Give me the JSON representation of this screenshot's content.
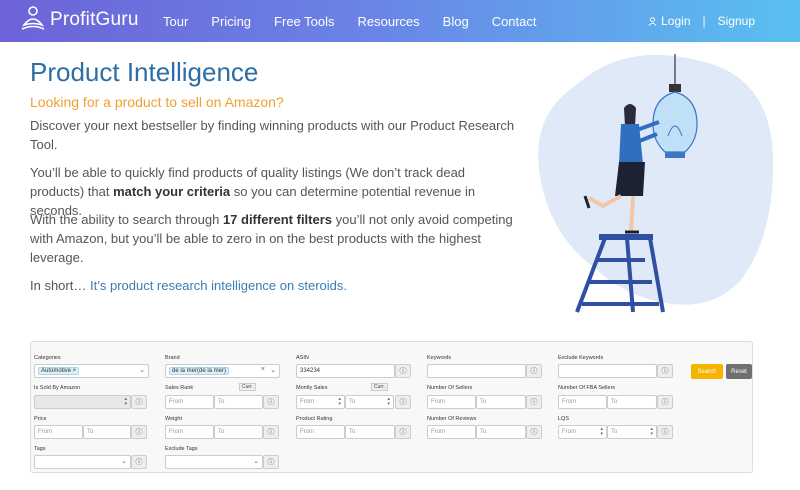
{
  "nav": {
    "logo_text": "ProfitGuru",
    "items": [
      "Tour",
      "Pricing",
      "Free Tools",
      "Resources",
      "Blog",
      "Contact"
    ],
    "login": "Login",
    "separator": "|",
    "signup": "Signup"
  },
  "hero": {
    "title": "Product Intelligence",
    "subtitle": "Looking for a product to sell on Amazon?",
    "p1": "Discover your next bestseller by finding winning products with our Product Research Tool.",
    "p2_a": "You’ll be able to quickly find products of quality listings (We don’t track dead products) that ",
    "p2_b": "match your criteria",
    "p2_c": " so you can determine potential revenue in seconds.",
    "p3_a": "With the ability to search through ",
    "p3_b": "17 different filters",
    "p3_c": " you’ll not only avoid competing with Amazon, but you’ll be able to zero in on the best products with the highest leverage.",
    "p4_a": "In short… ",
    "p4_b": "It’s product research intelligence on steroids."
  },
  "filters": {
    "categories_label": "Categories",
    "categories_chip": "Automotive ×",
    "brand_label": "Brand",
    "brand_chip": "de la mer(de la mer)",
    "asin_label": "ASIN",
    "asin_value": "334234",
    "keywords_label": "Keywords",
    "exclude_keywords_label": "Exclude Keywords",
    "search_btn": "Search",
    "reset_btn": "Reset",
    "sold_by_amazon_label": "Is Sold By Amazon",
    "sales_rank_label": "Sales Rank",
    "curr_label": "Curr.",
    "monthly_sales_label": "Montly Sales",
    "number_of_sellers_label": "Number Of Sellers",
    "number_of_fba_label": "Number Of FBA Sellers",
    "price_label": "Price",
    "weight_label": "Weight",
    "product_rating_label": "Product Rating",
    "number_of_reviews_label": "Number Of Reviews",
    "lqs_label": "LQS",
    "tags_label": "Tags",
    "exclude_tags_label": "Exclude Tags",
    "from": "From",
    "to": "To",
    "info_symbol": "ⓘ",
    "chevron": "⌄",
    "clear": "×"
  }
}
